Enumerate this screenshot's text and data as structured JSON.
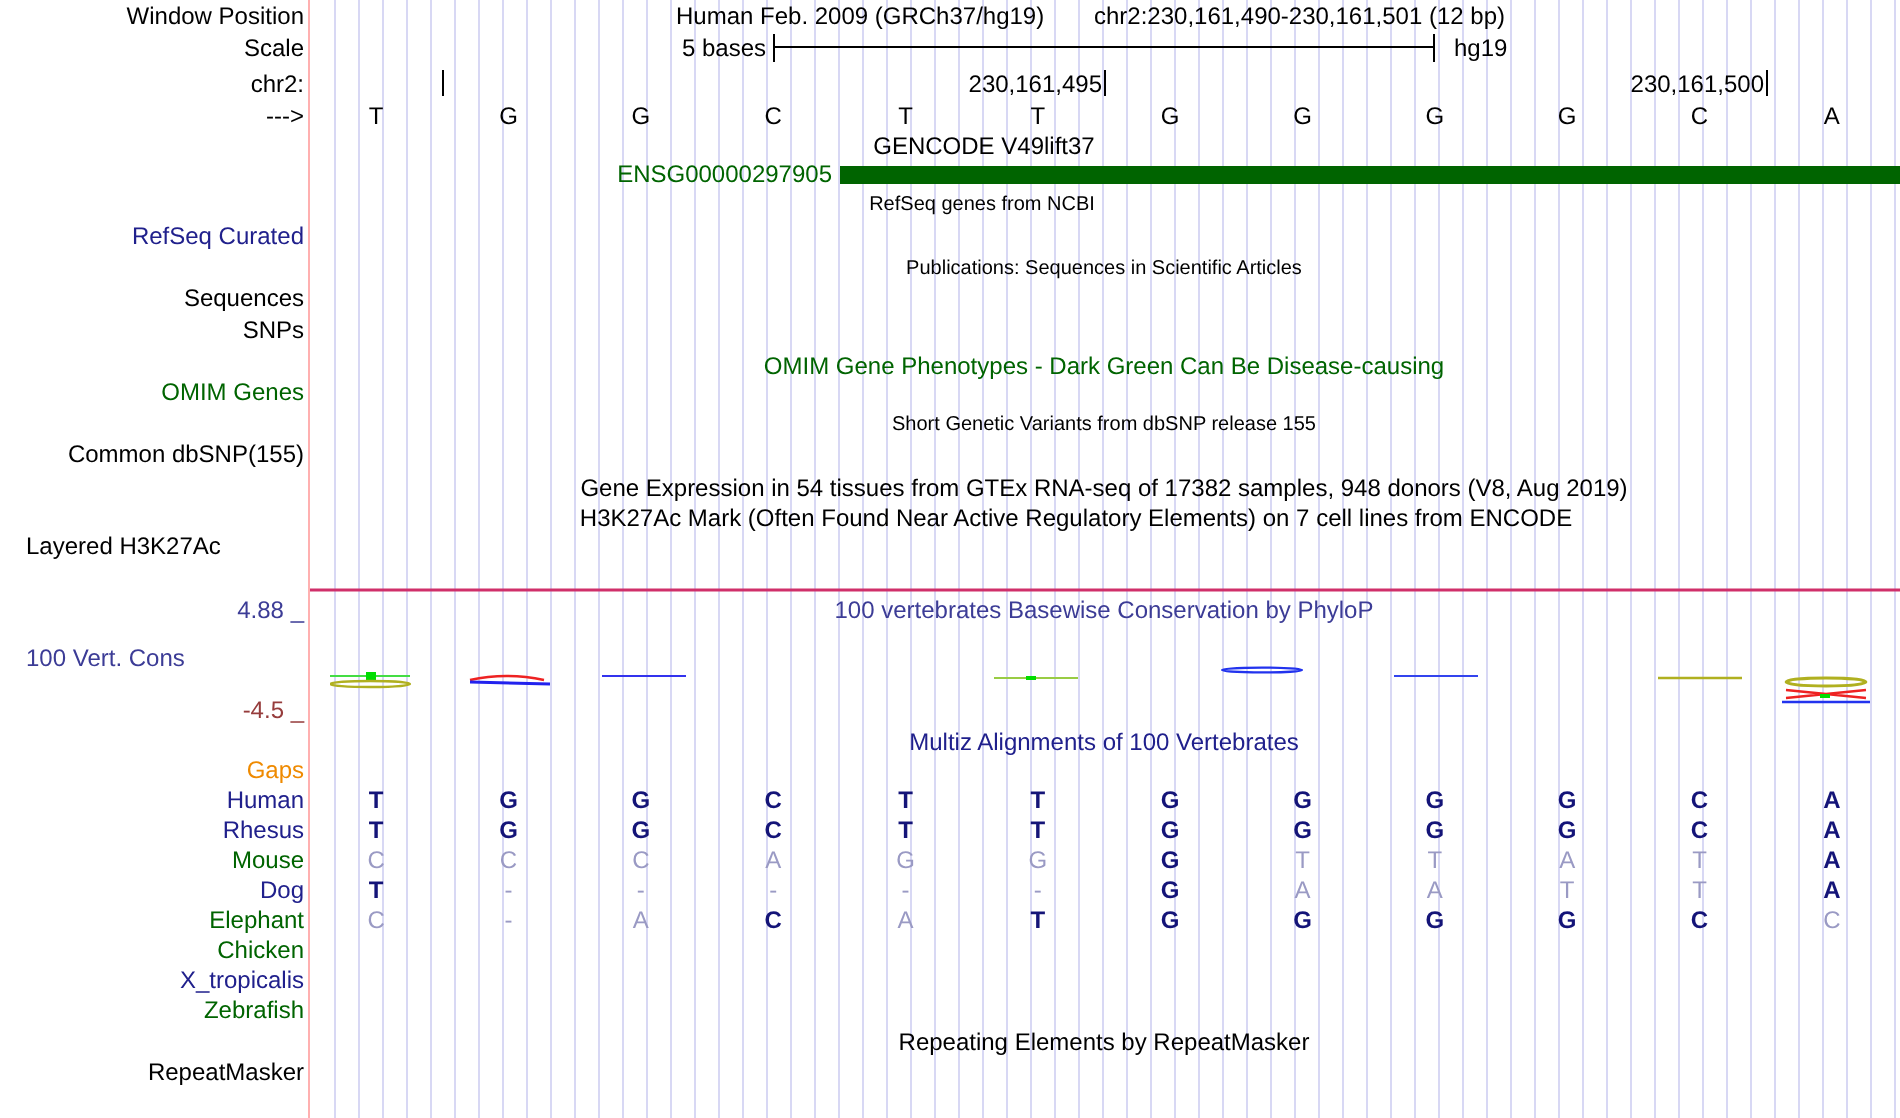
{
  "left_labels": [
    {
      "text": "Window Position",
      "color": "#000000"
    },
    {
      "text": "Scale",
      "color": "#000000"
    },
    {
      "text": "chr2:",
      "color": "#000000"
    },
    {
      "text": "--->",
      "color": "#000000"
    },
    {
      "text": "RefSeq Curated",
      "color": "#20208c"
    },
    {
      "text": "Sequences",
      "color": "#000000"
    },
    {
      "text": "SNPs",
      "color": "#000000"
    },
    {
      "text": "OMIM Genes",
      "color": "#006400"
    },
    {
      "text": "Common dbSNP(155)",
      "color": "#000000"
    },
    {
      "text": "Layered H3K27Ac",
      "color": "#000000"
    },
    {
      "text": "4.88 _",
      "color": "#3c3c96"
    },
    {
      "text": "100 Vert. Cons",
      "color": "#3c3c96"
    },
    {
      "text": "-4.5 _",
      "color": "#963c3c"
    },
    {
      "text": "Gaps",
      "color": "#ef8a00"
    },
    {
      "text": "RepeatMasker",
      "color": "#000000"
    }
  ],
  "window_position": {
    "assembly": "Human Feb. 2009 (GRCh37/hg19)",
    "range": "chr2:230,161,490-230,161,501 (12 bp)"
  },
  "scale": {
    "label": "5 bases",
    "db": "hg19"
  },
  "ruler_ticks": [
    "230,161,495",
    "230,161,500"
  ],
  "sequence": [
    "T",
    "G",
    "G",
    "C",
    "T",
    "T",
    "G",
    "G",
    "G",
    "G",
    "C",
    "A"
  ],
  "gene": {
    "name": "ENSG00000297905",
    "color": "#006400"
  },
  "track_titles": [
    {
      "text": "GENCODE V49lift37",
      "color": "#000000"
    },
    {
      "text": "RefSeq genes from NCBI",
      "color": "#000000"
    },
    {
      "text": "Publications: Sequences in Scientific Articles",
      "color": "#000000"
    },
    {
      "text": "OMIM Gene Phenotypes - Dark Green Can Be Disease-causing",
      "color": "#006400"
    },
    {
      "text": "Short Genetic Variants from dbSNP release 155",
      "color": "#000000"
    },
    {
      "text": "Gene Expression in 54 tissues from GTEx RNA-seq of 17382 samples, 948 donors (V8, Aug 2019)",
      "color": "#000000"
    },
    {
      "text": "H3K27Ac Mark (Often Found Near Active Regulatory Elements) on 7 cell lines from ENCODE",
      "color": "#000000"
    },
    {
      "text": "100 vertebrates Basewise Conservation by PhyloP",
      "color": "#3c3c96"
    },
    {
      "text": "Multiz Alignments of 100 Vertebrates",
      "color": "#20208c"
    },
    {
      "text": "Repeating Elements by RepeatMasker",
      "color": "#000000"
    }
  ],
  "alignment": [
    {
      "species": "Human",
      "color": "#20208c",
      "bases": [
        "T",
        "G",
        "G",
        "C",
        "T",
        "T",
        "G",
        "G",
        "G",
        "G",
        "C",
        "A"
      ],
      "match": [
        true,
        true,
        true,
        true,
        true,
        true,
        true,
        true,
        true,
        true,
        true,
        true
      ]
    },
    {
      "species": "Rhesus",
      "color": "#20208c",
      "bases": [
        "T",
        "G",
        "G",
        "C",
        "T",
        "T",
        "G",
        "G",
        "G",
        "G",
        "C",
        "A"
      ],
      "match": [
        true,
        true,
        true,
        true,
        true,
        true,
        true,
        true,
        true,
        true,
        true,
        true
      ]
    },
    {
      "species": "Mouse",
      "color": "#006400",
      "bases": [
        "C",
        "C",
        "C",
        "A",
        "G",
        "G",
        "G",
        "T",
        "T",
        "A",
        "T",
        "A"
      ],
      "match": [
        false,
        false,
        false,
        false,
        false,
        false,
        true,
        false,
        false,
        false,
        false,
        true
      ]
    },
    {
      "species": "Dog",
      "color": "#20208c",
      "bases": [
        "T",
        "-",
        "-",
        "-",
        "-",
        "-",
        "G",
        "A",
        "A",
        "T",
        "T",
        "A"
      ],
      "match": [
        true,
        false,
        false,
        false,
        false,
        false,
        true,
        false,
        false,
        false,
        false,
        true
      ]
    },
    {
      "species": "Elephant",
      "color": "#006400",
      "bases": [
        "C",
        "-",
        "A",
        "C",
        "A",
        "T",
        "G",
        "G",
        "G",
        "G",
        "C",
        "C"
      ],
      "match": [
        false,
        false,
        false,
        true,
        false,
        true,
        true,
        true,
        true,
        true,
        true,
        false
      ]
    },
    {
      "species": "Chicken",
      "color": "#006400"
    },
    {
      "species": "X_tropicalis",
      "color": "#20208c"
    },
    {
      "species": "Zebrafish",
      "color": "#006400"
    }
  ]
}
